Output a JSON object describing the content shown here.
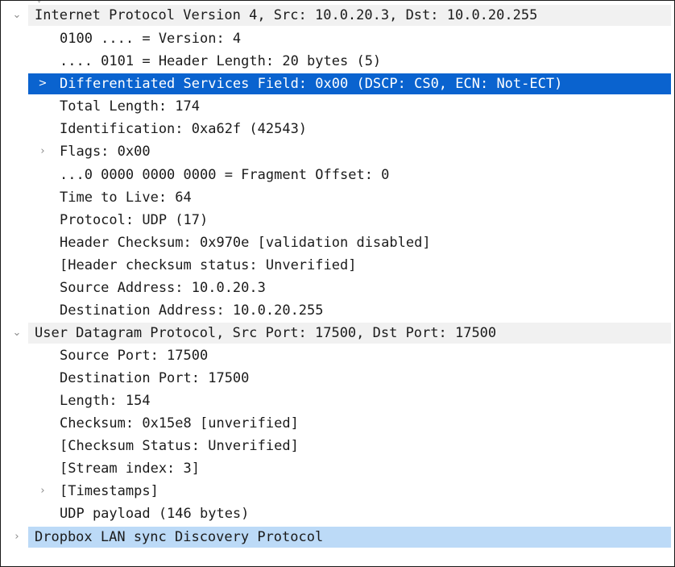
{
  "ip": {
    "header": "Internet Protocol Version 4, Src: 10.0.20.3, Dst: 10.0.20.255",
    "version": "0100 .... = Version: 4",
    "header_length": ".... 0101 = Header Length: 20 bytes (5)",
    "dsfield": "Differentiated Services Field: 0x00 (DSCP: CS0, ECN: Not-ECT)",
    "total_length": "Total Length: 174",
    "identification": "Identification: 0xa62f (42543)",
    "flags": "Flags: 0x00",
    "fragment_offset": "...0 0000 0000 0000 = Fragment Offset: 0",
    "ttl": "Time to Live: 64",
    "protocol": "Protocol: UDP (17)",
    "checksum": "Header Checksum: 0x970e [validation disabled]",
    "checksum_status": "[Header checksum status: Unverified]",
    "src": "Source Address: 10.0.20.3",
    "dst": "Destination Address: 10.0.20.255"
  },
  "udp": {
    "header": "User Datagram Protocol, Src Port: 17500, Dst Port: 17500",
    "src_port": "Source Port: 17500",
    "dst_port": "Destination Port: 17500",
    "length": "Length: 154",
    "checksum": "Checksum: 0x15e8 [unverified]",
    "checksum_status": "[Checksum Status: Unverified]",
    "stream_index": "[Stream index: 3]",
    "timestamps": "[Timestamps]",
    "payload": "UDP payload (146 bytes)"
  },
  "dropbox": {
    "header": "Dropbox LAN sync Discovery Protocol"
  },
  "glyphs": {
    "expanded": "⌄",
    "collapsed": "›",
    "selected": ">"
  }
}
